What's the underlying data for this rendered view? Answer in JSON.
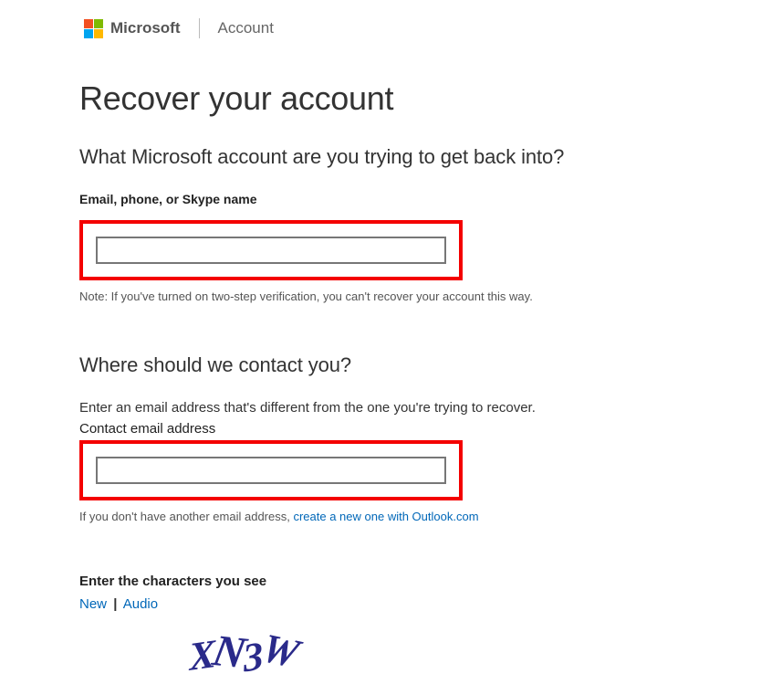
{
  "header": {
    "brand": "Microsoft",
    "subbrand": "Account"
  },
  "page": {
    "title": "Recover your account"
  },
  "section1": {
    "heading": "What Microsoft account are you trying to get back into?",
    "input_label": "Email, phone, or Skype name",
    "input_value": "",
    "note": "Note: If you've turned on two-step verification, you can't recover your account this way."
  },
  "section2": {
    "heading": "Where should we contact you?",
    "instruction": "Enter an email address that's different from the one you're trying to recover.",
    "input_label": "Contact email address",
    "input_value": "",
    "help_prefix": "If you don't have another email address, ",
    "help_link": "create a new one with Outlook.com"
  },
  "captcha": {
    "label": "Enter the characters you see",
    "new_link": "New",
    "separator": "|",
    "audio_link": "Audio",
    "text": "XN3W"
  }
}
